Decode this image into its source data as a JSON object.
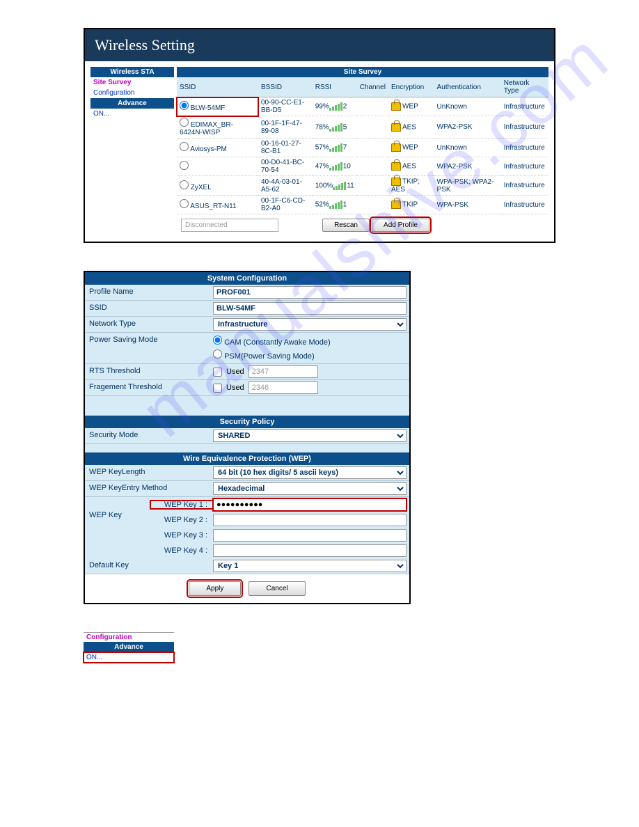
{
  "title": "Wireless Setting",
  "sidebar": {
    "header1": "Wireless STA",
    "items": [
      "Site Survey",
      "Configuration"
    ],
    "header2": "Advance",
    "on": "ON..."
  },
  "survey": {
    "header": "Site Survey",
    "cols": [
      "SSID",
      "BSSID",
      "RSSI",
      "Channel",
      "Encryption",
      "Authentication",
      "Network Type"
    ],
    "rows": [
      {
        "sel": true,
        "hl": true,
        "ssid": "BLW-54MF",
        "bssid": "00-90-CC-E1-BB-D5",
        "rssi": "99%",
        "ch": "2",
        "enc": "WEP",
        "auth": "UnKnown",
        "type": "Infrastructure"
      },
      {
        "sel": false,
        "ssid": "EDIMAX_BR-6424N-WISP",
        "bssid": "00-1F-1F-47-89-08",
        "rssi": "78%",
        "ch": "5",
        "enc": "AES",
        "auth": "WPA2-PSK",
        "type": "Infrastructure"
      },
      {
        "sel": false,
        "ssid": "Aviosys-PM",
        "bssid": "00-16-01-27-8C-B1",
        "rssi": "57%",
        "ch": "7",
        "enc": "WEP",
        "auth": "UnKnown",
        "type": "Infrastructure"
      },
      {
        "sel": false,
        "ssid": "",
        "bssid": "00-D0-41-BC-70-54",
        "rssi": "47%",
        "ch": "10",
        "enc": "AES",
        "auth": "WPA2-PSK",
        "type": "Infrastructure"
      },
      {
        "sel": false,
        "ssid": "ZyXEL",
        "bssid": "40-4A-03-01-A5-62",
        "rssi": "100%",
        "ch": "11",
        "enc": "TKIP; AES",
        "auth": "WPA-PSK; WPA2-PSK",
        "type": "Infrastructure"
      },
      {
        "sel": false,
        "ssid": "ASUS_RT-N11",
        "bssid": "00-1F-C6-CD-B2-A0",
        "rssi": "52%",
        "ch": "1",
        "enc": "TKIP",
        "auth": "WPA-PSK",
        "type": "Infrastructure"
      }
    ],
    "status": "Disconnected",
    "rescan": "Rescan",
    "addprofile": "Add Profile"
  },
  "syscfg": {
    "header": "System Configuration",
    "profile_label": "Profile Name",
    "profile": "PROF001",
    "ssid_label": "SSID",
    "ssid": "BLW-54MF",
    "nettype_label": "Network Type",
    "nettype": "Infrastructure",
    "psm_label": "Power Saving Mode",
    "psm_cam": "CAM (Constantly Awake Mode)",
    "psm_psm": "PSM(Power Saving Mode)",
    "rts_label": "RTS Threshold",
    "used": "Used",
    "rts_val": "2347",
    "frag_label": "Fragement Threshold",
    "frag_val": "2346"
  },
  "secpol": {
    "header": "Security Policy",
    "mode_label": "Security Mode",
    "mode": "SHARED"
  },
  "wep": {
    "header": "Wire Equivalence Protection (WEP)",
    "keylen_label": "WEP KeyLength",
    "keylen": "64 bit (10 hex digits/ 5 ascii keys)",
    "entry_label": "WEP KeyEntry Method",
    "entry": "Hexadecimal",
    "wepkey_label": "WEP Key",
    "keys": [
      "WEP Key 1 :",
      "WEP Key 2 :",
      "WEP Key 3 :",
      "WEP Key 4 :"
    ],
    "key1_val": "●●●●●●●●●●",
    "defkey_label": "Default Key",
    "defkey": "Key 1",
    "apply": "Apply",
    "cancel": "Cancel"
  },
  "panel3": {
    "top": "Configuration",
    "hdr": "Advance",
    "on": "ON..."
  }
}
